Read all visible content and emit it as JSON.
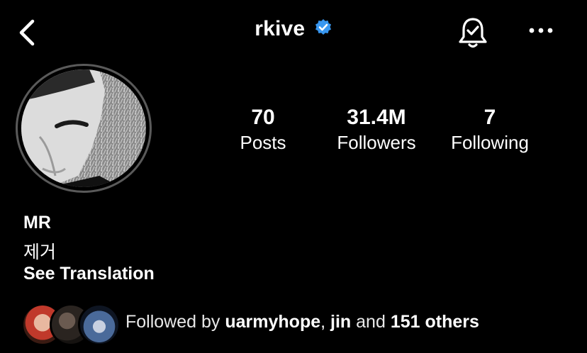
{
  "header": {
    "username": "rkive",
    "verified": true,
    "icons": [
      "back-arrow-icon",
      "verified-badge-icon",
      "notification-bell-icon",
      "more-options-icon"
    ],
    "accent_color": "#3897f0"
  },
  "stats": [
    {
      "value": "70",
      "label": "Posts"
    },
    {
      "value": "31.4M",
      "label": "Followers"
    },
    {
      "value": "7",
      "label": "Following"
    }
  ],
  "bio": {
    "name": "MR",
    "text": "제거",
    "translate_label": "See Translation"
  },
  "mutuals": {
    "prefix": "Followed by",
    "user1": "uarmyhope",
    "separator": ",",
    "user2": "jin",
    "conjunction": "and",
    "others": "151 others"
  }
}
